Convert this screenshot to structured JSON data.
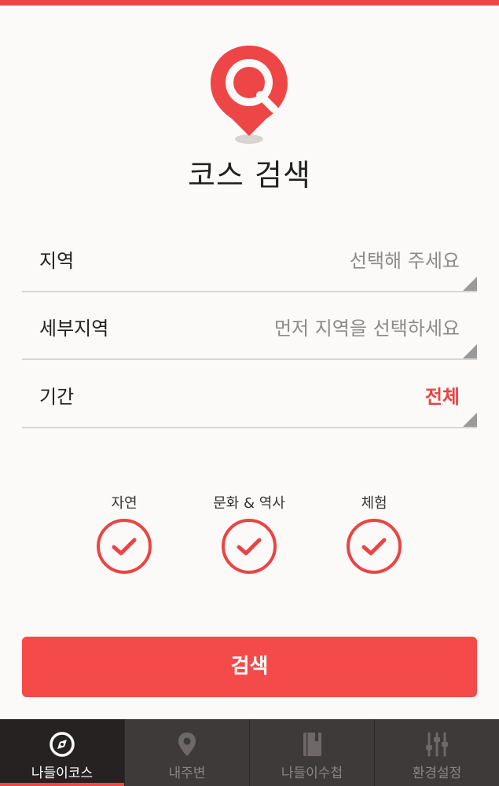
{
  "colors": {
    "accent": "#f04545",
    "background": "#fcfaf8",
    "tabbar": "#3e3a3a"
  },
  "header": {
    "logo_icon": "map-pin-search-icon",
    "title": "코스 검색"
  },
  "form": {
    "region": {
      "label": "지역",
      "value": "선택해 주세요"
    },
    "subregion": {
      "label": "세부지역",
      "value": "먼저 지역을 선택하세요"
    },
    "period": {
      "label": "기간",
      "value": "전체"
    }
  },
  "categories": [
    {
      "label": "자연",
      "checked": true
    },
    {
      "label": "문화 & 역사",
      "checked": true
    },
    {
      "label": "체험",
      "checked": true
    }
  ],
  "search_button": {
    "label": "검색"
  },
  "tabs": [
    {
      "label": "나들이코스",
      "icon": "compass-icon",
      "active": true
    },
    {
      "label": "내주변",
      "icon": "location-pin-icon",
      "active": false
    },
    {
      "label": "나들이수첩",
      "icon": "notebook-icon",
      "active": false
    },
    {
      "label": "환경설정",
      "icon": "sliders-icon",
      "active": false
    }
  ]
}
